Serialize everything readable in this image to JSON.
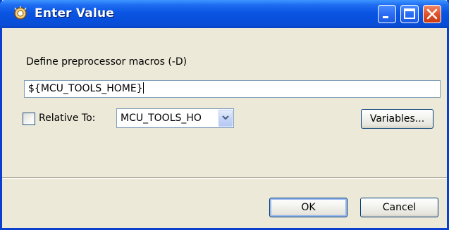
{
  "window": {
    "title": "Enter Value",
    "title_icon": "eclipse-gear-icon"
  },
  "titlebar_buttons": {
    "minimize": "minimize-icon",
    "maximize": "maximize-icon",
    "close": "close-icon"
  },
  "form": {
    "define_label": "Define preprocessor macros (-D)",
    "value": "${MCU_TOOLS_HOME}",
    "relative_to_label": "Relative To:",
    "relative_to_checked": false,
    "relative_to_value": "MCU_TOOLS_HO",
    "variables_label": "Variables..."
  },
  "actions": {
    "ok_label": "OK",
    "cancel_label": "Cancel"
  },
  "colors": {
    "titlebar": "#0a55e3",
    "dialog_background": "#ece9d8",
    "close_button": "#e0522c"
  }
}
